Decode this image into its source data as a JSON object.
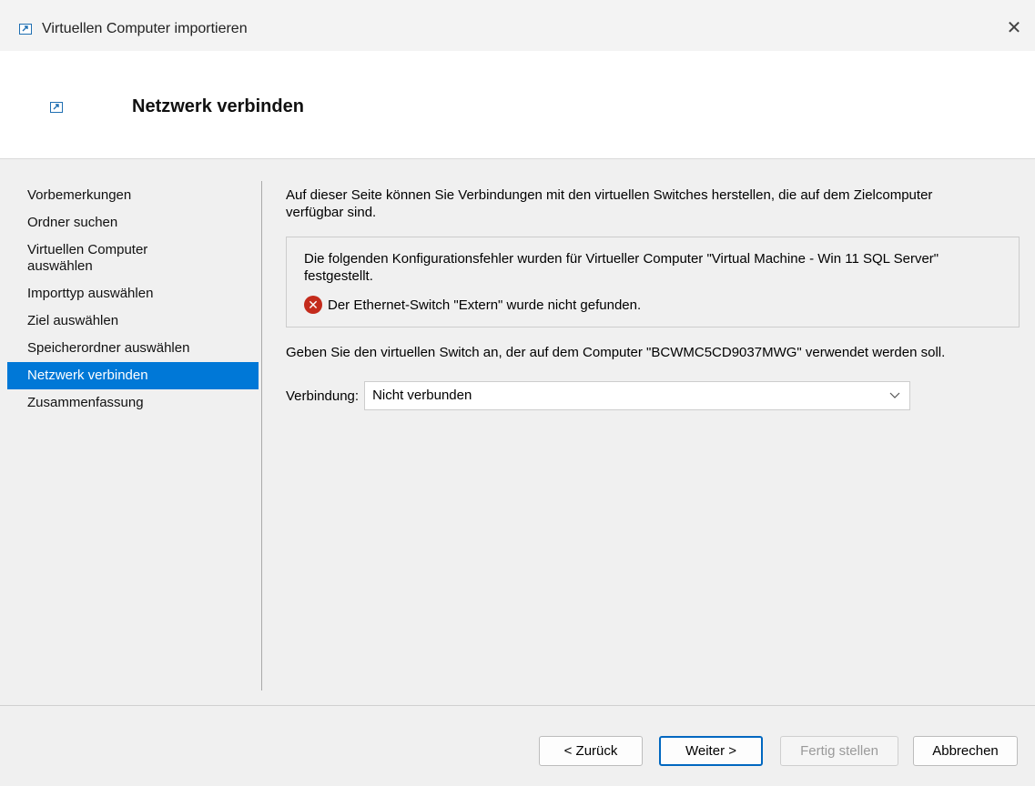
{
  "window": {
    "title": "Virtuellen Computer importieren",
    "close_glyph": "✕"
  },
  "header": {
    "title": "Netzwerk verbinden"
  },
  "nav": {
    "items": [
      {
        "label": "Vorbemerkungen"
      },
      {
        "label": "Ordner suchen"
      },
      {
        "label": "Virtuellen Computer auswählen"
      },
      {
        "label": "Importtyp auswählen"
      },
      {
        "label": "Ziel auswählen"
      },
      {
        "label": "Speicherordner auswählen"
      },
      {
        "label": "Netzwerk verbinden"
      },
      {
        "label": "Zusammenfassung"
      }
    ],
    "active_index": 6
  },
  "main": {
    "intro": "Auf dieser Seite können Sie Verbindungen mit den virtuellen Switches herstellen, die auf dem Zielcomputer verfügbar sind.",
    "error_box": {
      "message": "Die folgenden Konfigurationsfehler wurden für Virtueller Computer \"Virtual Machine - Win 11 SQL Server\" festgestellt.",
      "error_item": "Der Ethernet-Switch \"Extern\" wurde nicht gefunden."
    },
    "switch_prompt": "Geben Sie den virtuellen Switch an, der auf dem Computer \"BCWMC5CD9037MWG\" verwendet werden soll.",
    "connection": {
      "label": "Verbindung:",
      "value": "Nicht verbunden"
    }
  },
  "footer": {
    "back_label": "< Zurück",
    "next_label": "Weiter >",
    "finish_label": "Fertig stellen",
    "cancel_label": "Abbrechen"
  },
  "icons": {
    "app": "import-vm-icon",
    "error": "error-icon",
    "chevron": "chevron-down-icon",
    "close": "close-icon"
  },
  "colors": {
    "accent": "#0078d7",
    "error": "#c42b1c",
    "default_button_border": "#0067c0"
  }
}
